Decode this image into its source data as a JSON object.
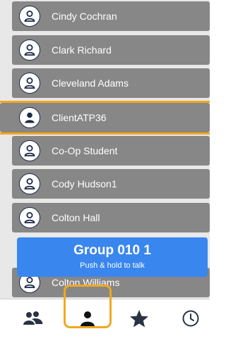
{
  "contacts": [
    {
      "name": "Cindy Cochran",
      "icon": "person-outline-icon"
    },
    {
      "name": "Clark Richard",
      "icon": "person-outline-icon"
    },
    {
      "name": "Cleveland Adams",
      "icon": "person-outline-icon"
    },
    {
      "name": "ClientATP36",
      "icon": "person-filled-icon",
      "selected": true
    },
    {
      "name": "Co-Op Student",
      "icon": "person-outline-icon"
    },
    {
      "name": "Cody Hudson1",
      "icon": "person-outline-icon"
    },
    {
      "name": "Colton Hall",
      "icon": "person-outline-icon"
    },
    {
      "name": "Colton Williams",
      "icon": "person-outline-icon"
    }
  ],
  "ptt_bar": {
    "group_name": "Group 010 1",
    "hint": "Push & hold to talk"
  },
  "tabs": [
    {
      "icon": "groups-icon"
    },
    {
      "icon": "contacts-icon",
      "selected": true
    },
    {
      "icon": "favorites-star-icon"
    },
    {
      "icon": "history-clock-icon"
    }
  ],
  "colors": {
    "row_bg": "#878787",
    "accent_highlight": "#f2a81f",
    "ptt_blue": "#3a86ef",
    "avatar_outline": "#1c2a48",
    "tab_icon": "#2a3344"
  }
}
